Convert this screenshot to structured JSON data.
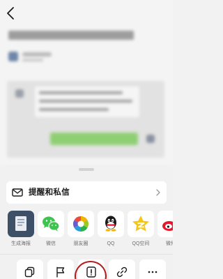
{
  "header": {
    "back_icon": "chevron-left-icon"
  },
  "sheet": {
    "remind": {
      "label": "提醒和私信",
      "icon": "envelope-icon",
      "chevron": "chevron-right-icon"
    },
    "share_targets": [
      {
        "label": "生成海报",
        "icon": "poster-icon"
      },
      {
        "label": "微信",
        "icon": "wechat-icon"
      },
      {
        "label": "朋友圈",
        "icon": "moments-icon"
      },
      {
        "label": "QQ",
        "icon": "qq-icon"
      },
      {
        "label": "QQ空间",
        "icon": "qzone-icon"
      },
      {
        "label": "微博",
        "icon": "weibo-icon"
      }
    ],
    "actions": [
      {
        "icon": "copy-icon"
      },
      {
        "icon": "flag-icon"
      },
      {
        "icon": "report-icon"
      },
      {
        "icon": "link-icon"
      },
      {
        "icon": "more-icon"
      }
    ]
  },
  "colors": {
    "annotation": "#b21e1e",
    "wechat_green": "#3fc34f",
    "qzone_yellow": "#f5c518",
    "weibo_red": "#e6162d"
  }
}
